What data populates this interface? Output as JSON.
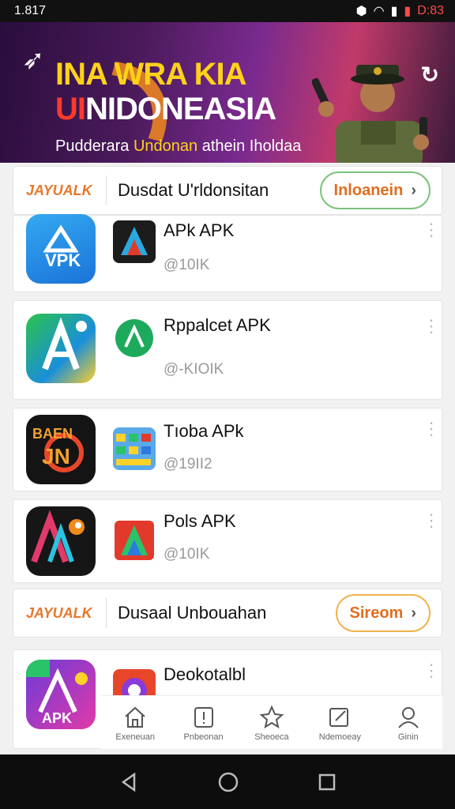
{
  "status": {
    "time": "1.817",
    "clock": "D:83"
  },
  "banner": {
    "line1": "INA WRA KIA",
    "line2_red": "UI",
    "line2_white": "NIDONEASIA",
    "line3_white": "Pudderara ",
    "line3_yellow": "Undonan",
    "line3_end": " athein Iholdaa"
  },
  "sections": [
    {
      "brand": "JAYUALK",
      "title": "Dusdat U'rldonsitan",
      "button": "Inloanein"
    },
    {
      "brand": "JAYUALK",
      "title": "Dusaal Unbouahan",
      "button": "Sireom"
    }
  ],
  "apps": [
    {
      "name": "APk APK",
      "size": "@10IK"
    },
    {
      "name": "Rppalcet APK",
      "size": "@-KIOIK"
    },
    {
      "name": "Tıoba APk",
      "size": "@19II2"
    },
    {
      "name": "Pols APK",
      "size": "@10IK"
    },
    {
      "name": "Deokotalbl",
      "size": ""
    }
  ],
  "nav": [
    {
      "label": "Exeneuan",
      "icon": "home-icon"
    },
    {
      "label": "Pnbeonan",
      "icon": "alert-icon"
    },
    {
      "label": "Sheoeca",
      "icon": "star-icon"
    },
    {
      "label": "Ndemoeay",
      "icon": "edit-icon"
    },
    {
      "label": "Ginin",
      "icon": "profile-icon"
    }
  ],
  "colors": {
    "accent": "#e06d1f",
    "brand": "#e8772a"
  }
}
